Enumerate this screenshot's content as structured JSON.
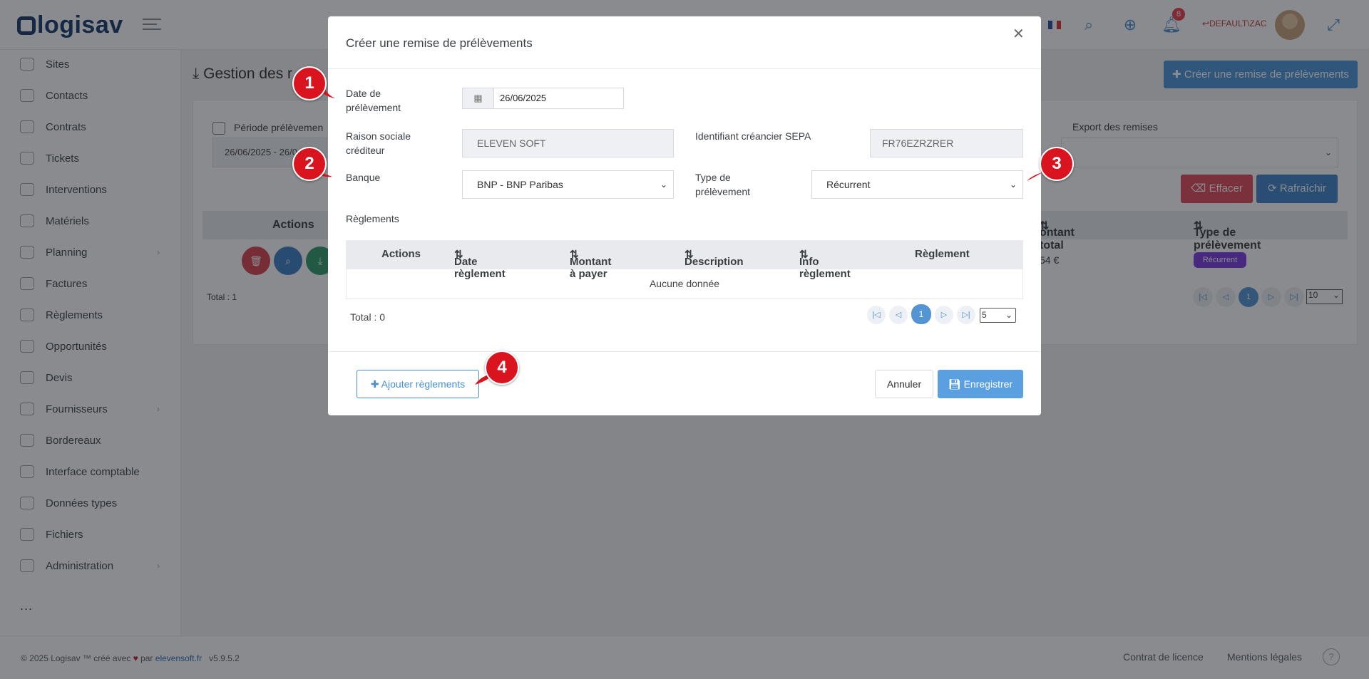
{
  "app": {
    "logo": "logisav",
    "user": "DEFAULT\\ZAC",
    "notif_count": "8"
  },
  "sidebar": {
    "items": [
      {
        "label": "Sites"
      },
      {
        "label": "Contacts"
      },
      {
        "label": "Contrats"
      },
      {
        "label": "Tickets"
      },
      {
        "label": "Interventions"
      },
      {
        "label": "Matériels"
      },
      {
        "label": "Planning"
      },
      {
        "label": "Factures"
      },
      {
        "label": "Règlements"
      },
      {
        "label": "Opportunités"
      },
      {
        "label": "Devis"
      },
      {
        "label": "Fournisseurs"
      },
      {
        "label": "Bordereaux"
      },
      {
        "label": "Interface comptable"
      },
      {
        "label": "Données types"
      },
      {
        "label": "Fichiers"
      },
      {
        "label": "Administration"
      }
    ],
    "more": "..."
  },
  "page": {
    "title": "Gestion des r",
    "create_btn": "Créer une remise de prélèvements",
    "period_label": "Période prélèvemen",
    "period_value": "26/06/2025 - 26/0",
    "export_label": "Export des remises",
    "btn_effacer": "Effacer",
    "btn_rafraichir": "Rafraîchir",
    "table_headers": {
      "actions": "Actions",
      "montant": "ontant total",
      "type": "Type de prélèvement"
    },
    "row": {
      "montant": "54 €",
      "type": "Récurrent"
    },
    "total": "Total : 1",
    "page_current": "1",
    "page_size": "10"
  },
  "footer": {
    "copyright": "© 2025 Logisav ™ créé avec",
    "par": "par",
    "link": "elevensoft.fr",
    "version": "v5.9.5.2",
    "license": "Contrat de licence",
    "legal": "Mentions légales"
  },
  "modal": {
    "title": "Créer une remise de prélèvements",
    "date_label": "Date de prélèvement",
    "date_value": "26/06/2025",
    "raison_label": "Raison sociale créditeur",
    "raison_value": "ELEVEN SOFT",
    "sepa_label": "Identifiant créancier SEPA",
    "sepa_value": "FR76EZRZRER",
    "banque_label": "Banque",
    "banque_value": "BNP - BNP Paribas",
    "type_label": "Type de prélèvement",
    "type_value": "Récurrent",
    "reglements_label": "Règlements",
    "headers": [
      "Actions",
      "Date règlement",
      "Montant à payer",
      "Description",
      "Info règlement",
      "Règlement"
    ],
    "empty": "Aucune donnée",
    "total": "Total : 0",
    "page_current": "1",
    "page_size": "5",
    "btn_add": "Ajouter règlements",
    "btn_cancel": "Annuler",
    "btn_save": "Enregistrer"
  },
  "callouts": [
    "1",
    "2",
    "3",
    "4"
  ],
  "colors": {
    "primary": "#4f94d8",
    "danger": "#e04a58",
    "callout": "#d9141e",
    "tag": "#7a3ae0"
  }
}
